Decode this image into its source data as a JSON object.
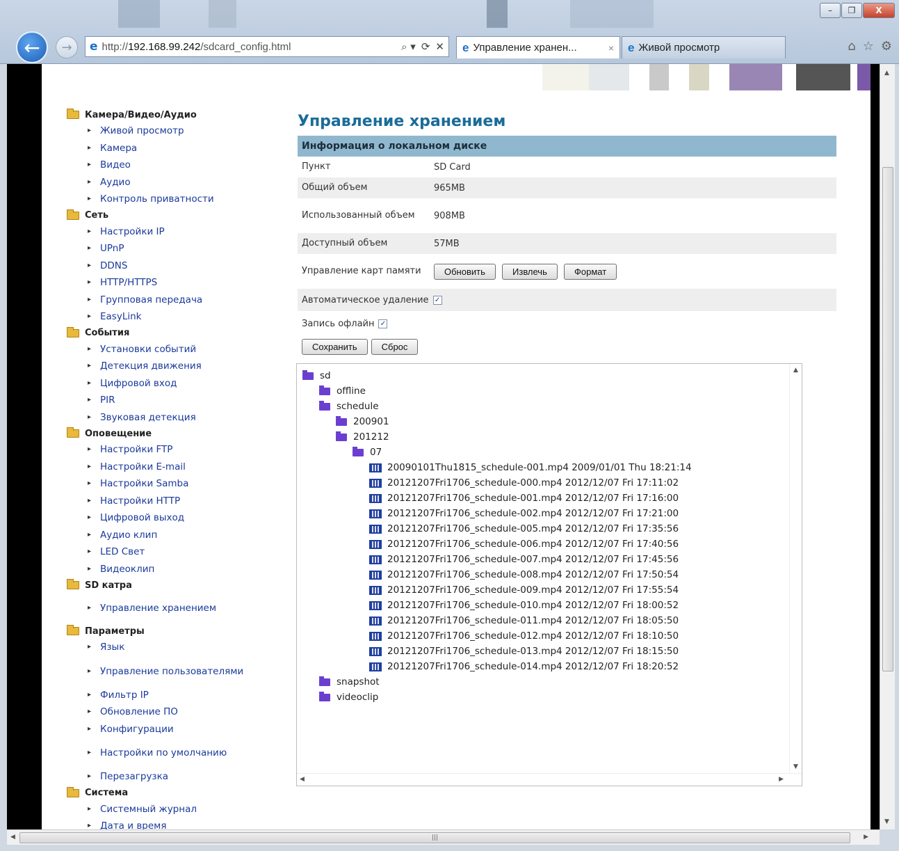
{
  "browser": {
    "url_prefix": "http://",
    "url_host": "192.168.99.242",
    "url_path": "/sdcard_config.html",
    "tabs": [
      {
        "label": "Управление хранен...",
        "close": "×"
      },
      {
        "label": "Живой просмотр"
      }
    ],
    "addr_tools": [
      "⌕ ▾",
      "⟳",
      "✕"
    ],
    "icons": [
      "home-icon",
      "star-icon",
      "gear-icon"
    ],
    "window_buttons": [
      "–",
      "❐",
      "X"
    ]
  },
  "sidebar": [
    {
      "category": "Камера/Видео/Аудио",
      "items": [
        "Живой просмотр",
        "Камера",
        "Видео",
        "Аудио",
        "Контроль приватности"
      ]
    },
    {
      "category": "Сеть",
      "items": [
        "Настройки IP",
        "UPnP",
        "DDNS",
        "HTTP/HTTPS",
        "Групповая передача",
        "EasyLink"
      ]
    },
    {
      "category": "События",
      "items": [
        "Установки событий",
        "Детекция движения",
        "Цифровой вход",
        "PIR",
        "Звуковая детекция"
      ]
    },
    {
      "category": "Оповещение",
      "items": [
        "Настройки FTP",
        "Настройки E-mail",
        "Настройки Samba",
        "Настройки HTTP",
        "Цифровой выход",
        "Аудио клип",
        "LED Свет",
        "Видеоклип"
      ]
    },
    {
      "category": "SD катра",
      "items": [
        "Управление хранением"
      ]
    },
    {
      "category": "Параметры",
      "items": [
        "Язык",
        "Управление пользователями",
        "Фильтр IP",
        "Обновление ПО",
        "Конфигурации",
        "Настройки по умолчанию",
        "Перезагрузка"
      ]
    },
    {
      "category": "Система",
      "items": [
        "Системный журнал",
        "Дата и время"
      ]
    }
  ],
  "main": {
    "title": "Управление хранением",
    "section": "Информация о локальном диске",
    "rows": [
      {
        "label": "Пункт",
        "value": "SD Card"
      },
      {
        "label": "Общий объем",
        "value": "965MB"
      },
      {
        "label": "Использованный объем",
        "value": "908MB"
      },
      {
        "label": "Доступный объем",
        "value": "57MB"
      }
    ],
    "card_label": "Управление карт памяти",
    "card_buttons": [
      "Обновить",
      "Извлечь",
      "Формат"
    ],
    "auto_delete_label": "Автоматическое удаление",
    "auto_delete_checked": true,
    "offline_label": "Запись офлайн",
    "offline_checked": true,
    "check_mark": "✓",
    "save_label": "Сохранить",
    "reset_label": "Сброс"
  },
  "tree": {
    "root": "sd",
    "folders_top": [
      "offline",
      "schedule"
    ],
    "schedule_children": [
      "200901",
      "201212"
    ],
    "sub": "07",
    "files": [
      "20090101Thu1815_schedule-001.mp4 2009/01/01 Thu 18:21:14",
      "20121207Fri1706_schedule-000.mp4 2012/12/07 Fri 17:11:02",
      "20121207Fri1706_schedule-001.mp4 2012/12/07 Fri 17:16:00",
      "20121207Fri1706_schedule-002.mp4 2012/12/07 Fri 17:21:00",
      "20121207Fri1706_schedule-005.mp4 2012/12/07 Fri 17:35:56",
      "20121207Fri1706_schedule-006.mp4 2012/12/07 Fri 17:40:56",
      "20121207Fri1706_schedule-007.mp4 2012/12/07 Fri 17:45:56",
      "20121207Fri1706_schedule-008.mp4 2012/12/07 Fri 17:50:54",
      "20121207Fri1706_schedule-009.mp4 2012/12/07 Fri 17:55:54",
      "20121207Fri1706_schedule-010.mp4 2012/12/07 Fri 18:00:52",
      "20121207Fri1706_schedule-011.mp4 2012/12/07 Fri 18:05:50",
      "20121207Fri1706_schedule-012.mp4 2012/12/07 Fri 18:10:50",
      "20121207Fri1706_schedule-013.mp4 2012/12/07 Fri 18:15:50",
      "20121207Fri1706_schedule-014.mp4 2012/12/07 Fri 18:20:52"
    ],
    "folders_bottom": [
      "snapshot",
      "videoclip"
    ]
  },
  "colors": {
    "title": "#1a6c98",
    "section_bg": "#8fb8ce",
    "link": "#1a3a9a",
    "tree_folder": "#6a3fd0"
  }
}
